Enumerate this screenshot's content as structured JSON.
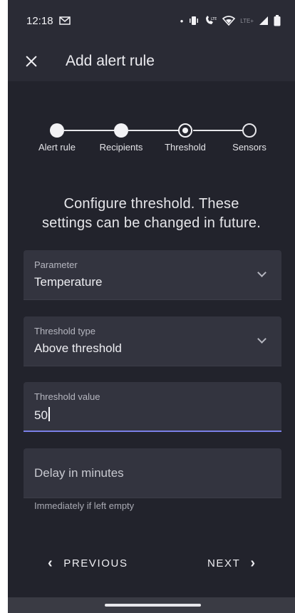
{
  "status_bar": {
    "time": "12:18",
    "mail_icon": "mail-icon",
    "dot": "•",
    "lte_label": "LTE+"
  },
  "app_bar": {
    "title": "Add alert rule",
    "close_icon": "close-icon"
  },
  "stepper": {
    "steps": [
      {
        "label": "Alert rule",
        "state": "done"
      },
      {
        "label": "Recipients",
        "state": "done"
      },
      {
        "label": "Threshold",
        "state": "active"
      },
      {
        "label": "Sensors",
        "state": "todo"
      }
    ]
  },
  "heading": {
    "line1": "Configure threshold. These",
    "line2": "settings can be changed in future."
  },
  "form": {
    "parameter": {
      "label": "Parameter",
      "value": "Temperature"
    },
    "threshold_type": {
      "label": "Threshold type",
      "value": "Above threshold"
    },
    "threshold_value": {
      "label": "Threshold value",
      "value": "50"
    },
    "delay": {
      "placeholder": "Delay in minutes",
      "helper": "Immediately if left empty"
    }
  },
  "navigation": {
    "previous_label": "PREVIOUS",
    "next_label": "NEXT",
    "previous_arrow": "‹",
    "next_arrow": "›"
  },
  "colors": {
    "background": "#22232c",
    "surface": "#33343f",
    "accent": "#7b80e6"
  }
}
